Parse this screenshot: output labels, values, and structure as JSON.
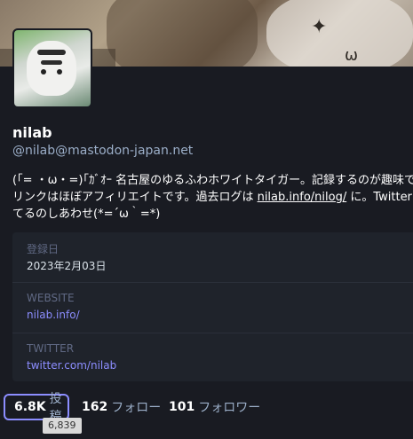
{
  "profile": {
    "display_name": "nilab",
    "acct": "@nilab@mastodon-japan.net",
    "bio": {
      "line1": "(｢= ・ω・=)｢ｶﾞｵｰ 名古屋のゆるふわホワイトタイガー。記録するのが趣味で",
      "line2_pre": "リンクはほぼアフィリエイトです。過去ログは ",
      "line2_link": "nilab.info/nilog/",
      "line2_post": " に。Twitter",
      "line3": "てるのしあわせ(*=´ω｀=*)"
    }
  },
  "fields": [
    {
      "label": "登録日",
      "value": "2023年2月03日"
    },
    {
      "label": "WEBSITE",
      "value": "nilab.info/"
    },
    {
      "label": "TWITTER",
      "value": "twitter.com/nilab"
    }
  ],
  "counts": {
    "posts": {
      "num": "6.8K",
      "label": "投稿"
    },
    "following": {
      "num": "162",
      "label": "フォロー"
    },
    "followers": {
      "num": "101",
      "label": "フォロワー"
    }
  },
  "tooltip": "6,839",
  "colors": {
    "background": "#191b22",
    "accent": "#8c8dff",
    "muted": "#9baec8"
  }
}
